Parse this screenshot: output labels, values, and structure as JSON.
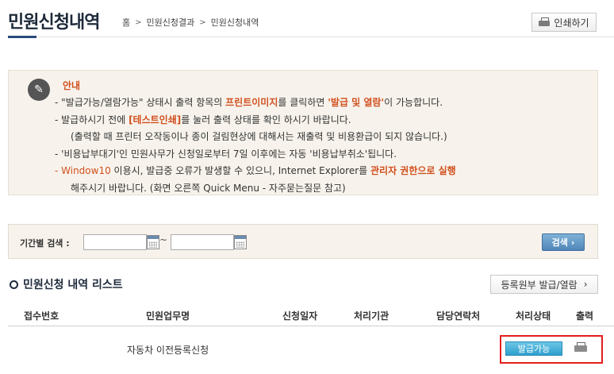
{
  "header": {
    "title": "민원신청내역",
    "breadcrumb": [
      "홈",
      "민원신청결과",
      "민원신청내역"
    ],
    "print_label": "인쇄하기"
  },
  "notice": {
    "title": "안내",
    "line1_a": "- \"발급가능/열람가능\" 상태시 출력 항목의 ",
    "line1_hl": "프린트이미지",
    "line1_b": "를 클릭하면 ",
    "line1_hl2": "'발급 및 열람'",
    "line1_c": "이 가능합니다.",
    "line2_a": "- 발급하시기 전에 ",
    "line2_hl": "[테스트인쇄]",
    "line2_b": "를 눌러 출력 상태를 확인 하시기 바랍니다.",
    "line3": "(출력할 때 프린터 오작동이나 종이 걸림현상에 대해서는 재출력 및 비용환급이 되지 않습니다.)",
    "line4": "- '비용납부대기'인 민원사무가 신청일로부터 7일 이후에는 자동 '비용납부취소'됩니다.",
    "line5_hl": "- Window10",
    "line5_a": " 이용시, 발급중 오류가 발생할 수 있으니, Internet Explorer를 ",
    "line5_hl2": "관리자 권한으로 실행",
    "line6": "해주시기 바랍니다. (화면 오른쪽 Quick Menu - 자주묻는질문 참고)"
  },
  "search": {
    "label": "기간별 검색 :",
    "tilde": "~",
    "start_value": "",
    "end_value": "",
    "button_label": "검색",
    "button_arrow": "›"
  },
  "list": {
    "title": "민원신청 내역 리스트",
    "reg_button_label": "등록원부 발급/열람",
    "reg_button_arrow": "›",
    "columns": [
      "접수번호",
      "민원업무명",
      "신청일자",
      "처리기관",
      "담당연락처",
      "처리상태",
      "출력"
    ],
    "rows": [
      {
        "receipt_no": "",
        "task_name": "자동차 이전등록신청",
        "date": "",
        "agency": "",
        "contact": "",
        "status": "발급가능"
      }
    ]
  }
}
